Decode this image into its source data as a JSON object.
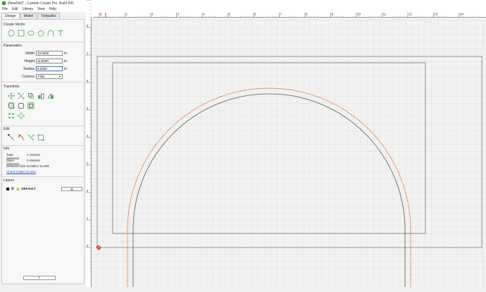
{
  "window": {
    "title": "[NewFile]* - Carbide Create Pro, Build 845"
  },
  "menu": [
    "File",
    "Edit",
    "Library",
    "View",
    "Help"
  ],
  "tabs": [
    {
      "label": "Design",
      "active": true
    },
    {
      "label": "Model",
      "active": false
    },
    {
      "label": "Toolpaths",
      "active": false
    }
  ],
  "sections": {
    "create_vector": "Create Vector",
    "parameters": "Parameters",
    "transform": "Transform",
    "edit": "Edit",
    "info": "Info",
    "layers": "Layers"
  },
  "params": {
    "width_label": "Width",
    "width_value": "10.5000",
    "height_label": "Height",
    "height_value": "11.5000",
    "radius_label": "Radius",
    "radius_value": "5.2500",
    "corners_label": "Corners",
    "corners_value": "Fillet",
    "unit": "in"
  },
  "info": {
    "total_label": "Total Selected:",
    "total_value": "1 Vectors",
    "open_label": "Open Selected:",
    "open_value": "0 Vectors",
    "size_label": "Selected Size:",
    "size_value": "10.500 x 11.500",
    "link": "Check Cutter Access"
  },
  "layers": [
    {
      "name": "DEFAULT",
      "color": "#000000"
    }
  ],
  "add_layer_label": "+",
  "ruler_h": [
    "0",
    "1",
    "2",
    "3",
    "4",
    "5",
    "6",
    "7",
    "8",
    "9",
    "10",
    "11",
    "12",
    "13",
    "14"
  ],
  "ruler_v": [
    "9",
    "8",
    "7",
    "6",
    "5",
    "4",
    "3",
    "2",
    "1",
    "0"
  ],
  "colors": {
    "accent": "#4caf50",
    "toolpath": "#e05a1a",
    "link": "#1a4fc9"
  }
}
